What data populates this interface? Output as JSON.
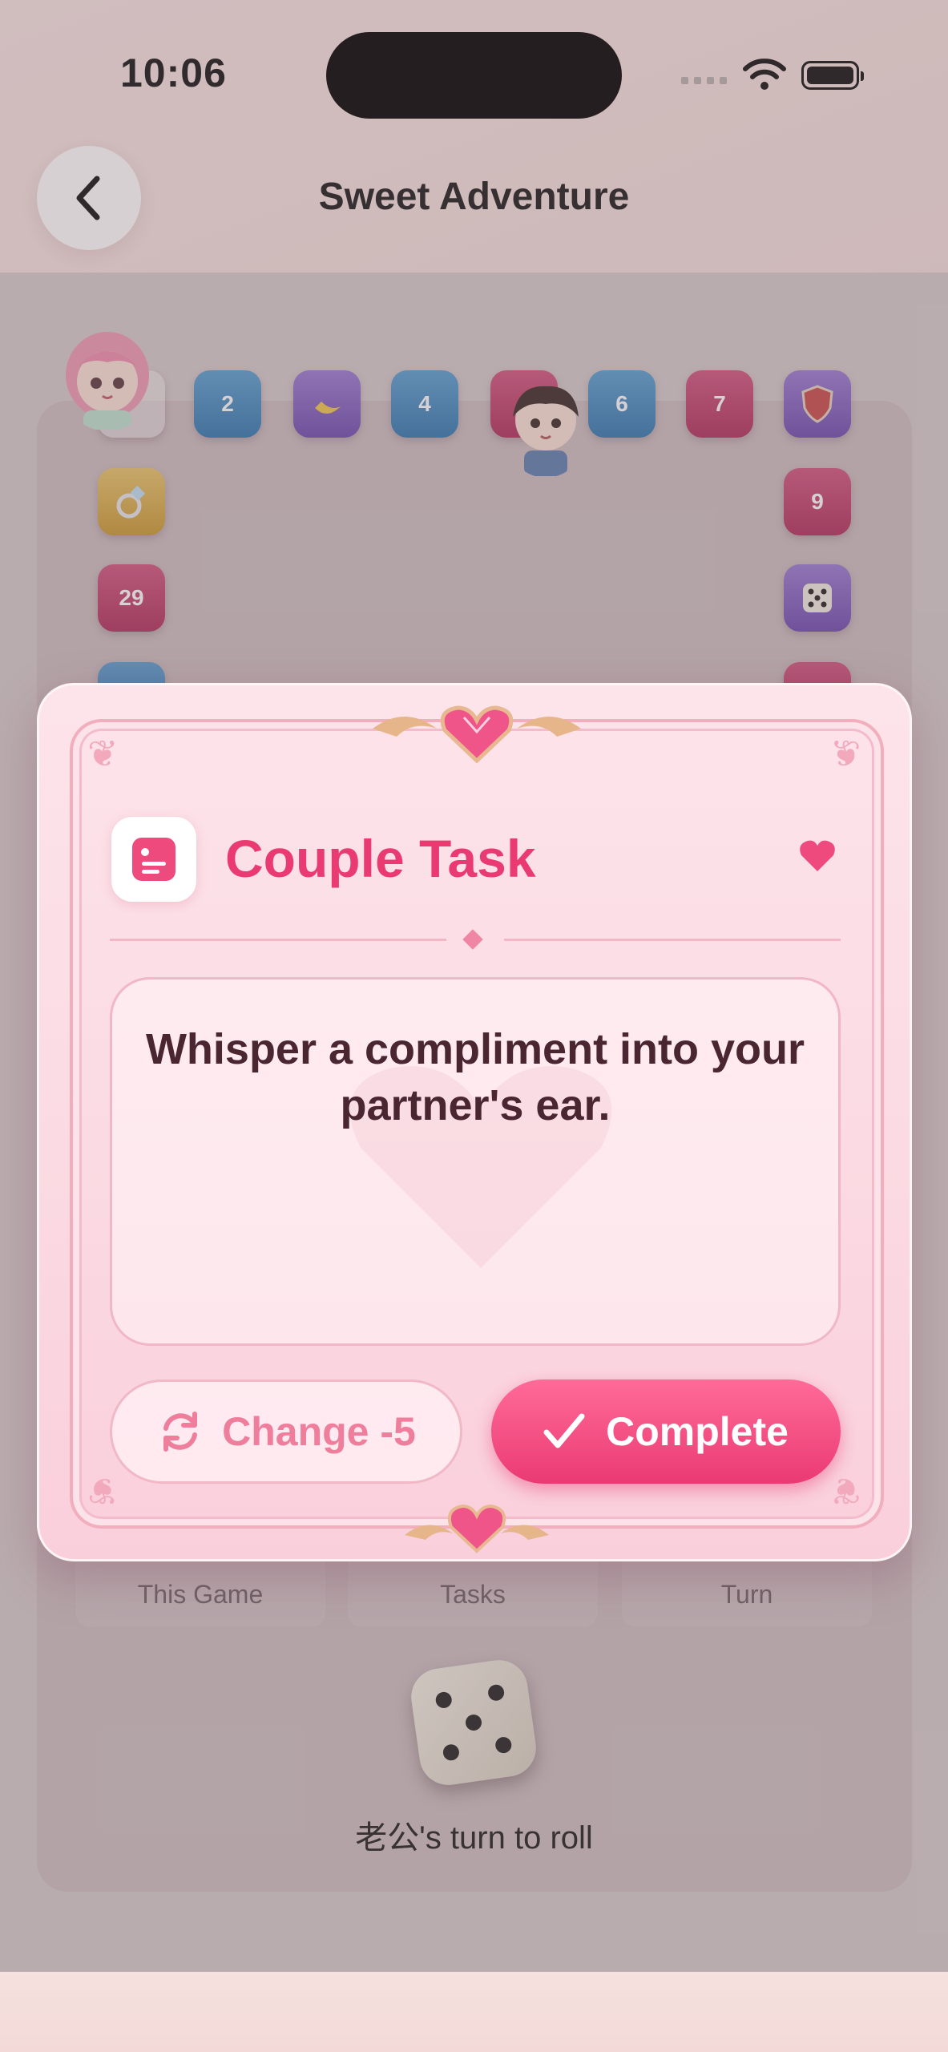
{
  "status_bar": {
    "time": "10:06"
  },
  "header": {
    "title": "Sweet Adventure"
  },
  "board": {
    "tiles": [
      {
        "label": "2",
        "icon": null
      },
      {
        "label": "",
        "icon": "banana-icon"
      },
      {
        "label": "4",
        "icon": null
      },
      {
        "label": "6",
        "icon": null
      },
      {
        "label": "7",
        "icon": null
      },
      {
        "label": "",
        "icon": "shield-icon"
      },
      {
        "label": "",
        "icon": "ring-icon"
      },
      {
        "label": "9",
        "icon": null
      },
      {
        "label": "29",
        "icon": null
      },
      {
        "label": "",
        "icon": "dice-icon"
      }
    ]
  },
  "stats": {
    "this_game": "This Game",
    "tasks": "Tasks",
    "turn": "Turn"
  },
  "turn_prompt": "老公's turn to roll",
  "modal": {
    "title": "Couple Task",
    "task_text": "Whisper a compliment into your partner's ear.",
    "change_label": "Change -5",
    "complete_label": "Complete"
  },
  "colors": {
    "accent": "#e93b72",
    "complete_button": "#f0467c",
    "modal_bg": "#fbdbe3"
  }
}
